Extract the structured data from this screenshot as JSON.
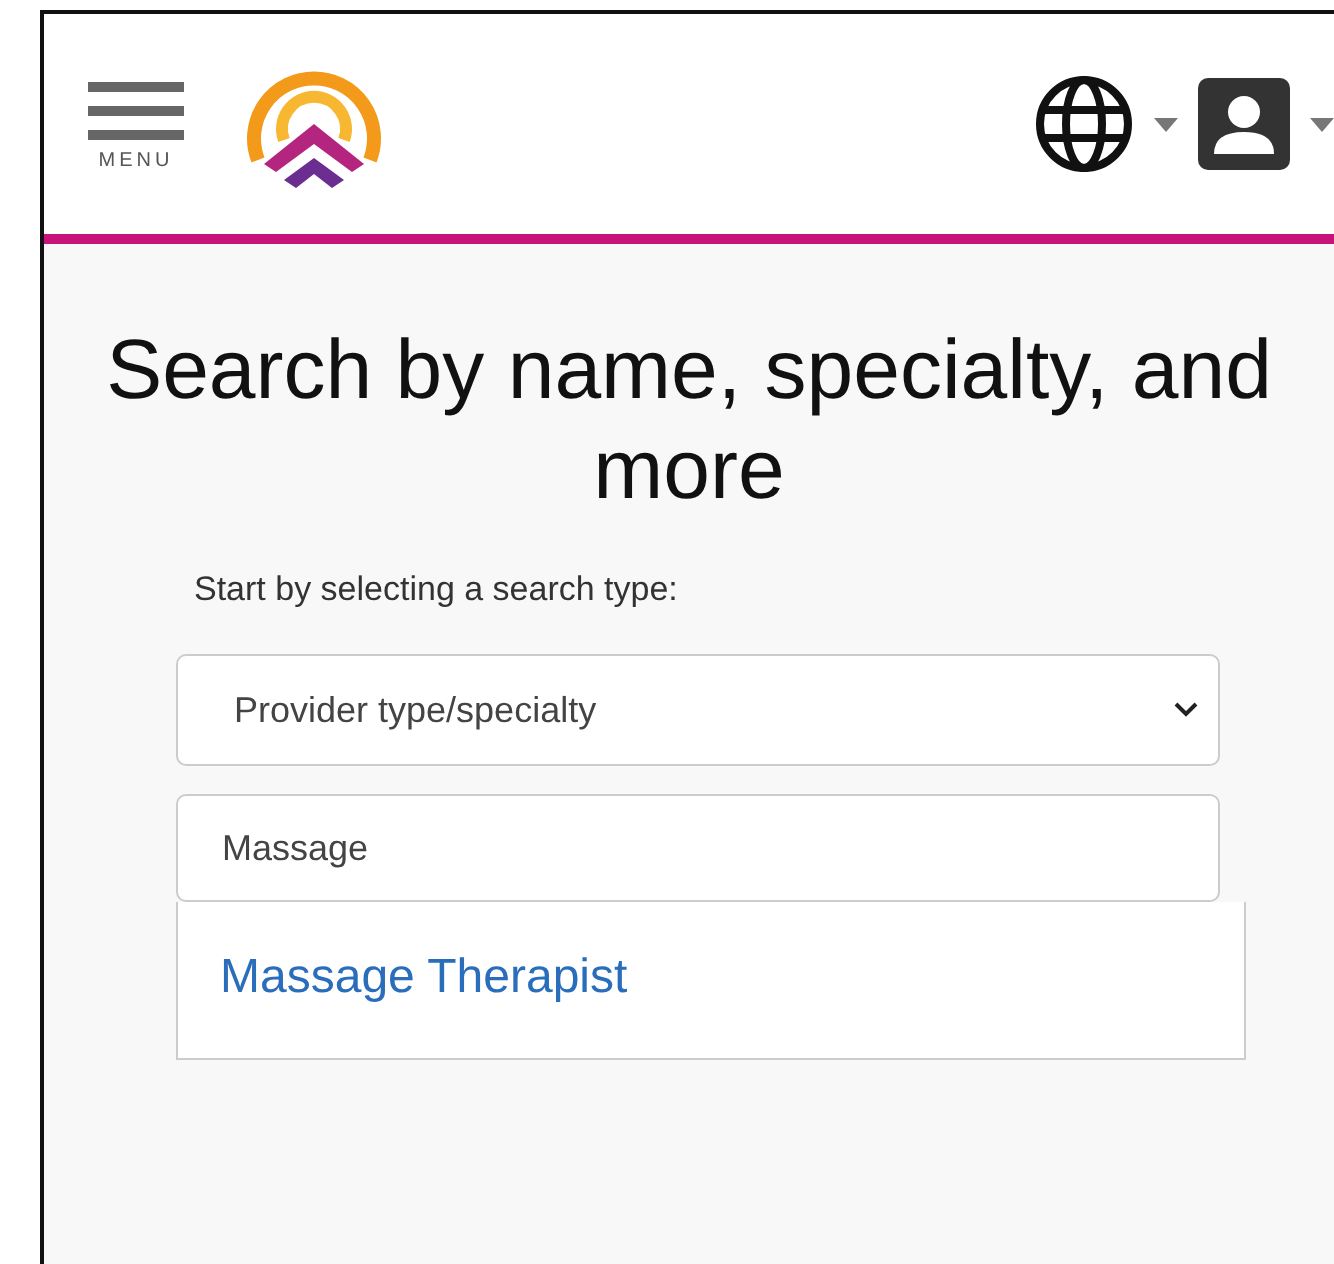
{
  "header": {
    "menu_label": "MENU"
  },
  "heading": "Search by name, specialty, and more",
  "search": {
    "prompt": "Start by selecting a search type:",
    "search_type": "Provider type/specialty",
    "query": "Massage",
    "suggestions": [
      {
        "label": "Massage Therapist"
      }
    ]
  }
}
